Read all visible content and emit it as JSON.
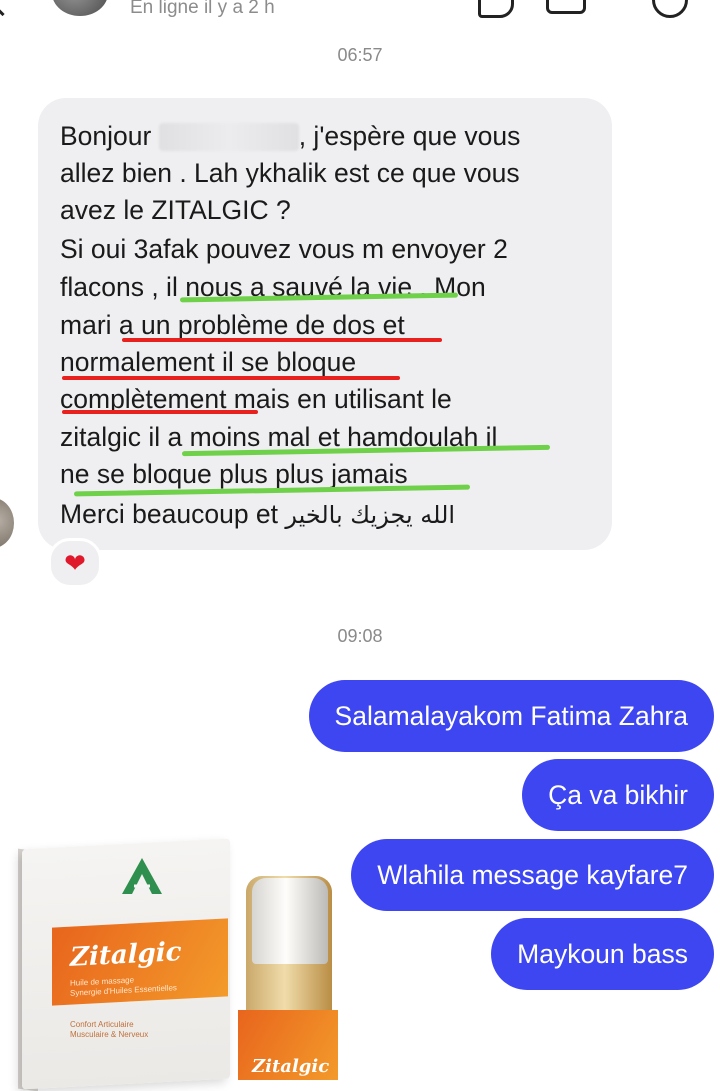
{
  "header": {
    "status": "En ligne il y a 2 h"
  },
  "timestamps": {
    "first": "06:57",
    "second": "09:08"
  },
  "incoming_message": {
    "lines": [
      {
        "pre": "Bonjour ",
        "post": ", j'espère que vous"
      },
      "allez bien . Lah ykhalik est ce que vous",
      "avez le ZITALGIC ?",
      "Si oui 3afak pouvez vous m envoyer 2",
      "flacons , il nous a sauvé la vie . Mon",
      "mari a un problème de dos et",
      "normalement il se bloque",
      "complètement mais en utilisant le",
      "zitalgic il a moins mal et hamdoulah il",
      "ne se bloque plus plus jamais",
      {
        "pre": "Merci beaucoup et ",
        "arabic": "الله يجزيك بالخير"
      }
    ],
    "reaction": "❤",
    "highlight_colors": {
      "green": "#6fd14a",
      "red": "#e8201e"
    }
  },
  "outgoing_messages": [
    "Salamalayakom Fatima Zahra",
    "Ça va bikhir",
    "Wlahila message kayfare7",
    "Maykoun bass"
  ],
  "colors": {
    "outgoing_bubble": "#3d46f0",
    "incoming_bubble": "#efeff1"
  },
  "product_photo": {
    "box_name": "Zitalgic",
    "box_subtitle": [
      "Huile de massage",
      "Synergie d'Huiles Essentielles"
    ],
    "box_footer": [
      "Confort Articulaire",
      "Musculaire & Nerveux"
    ],
    "bottle_name": "Zitalgic"
  }
}
